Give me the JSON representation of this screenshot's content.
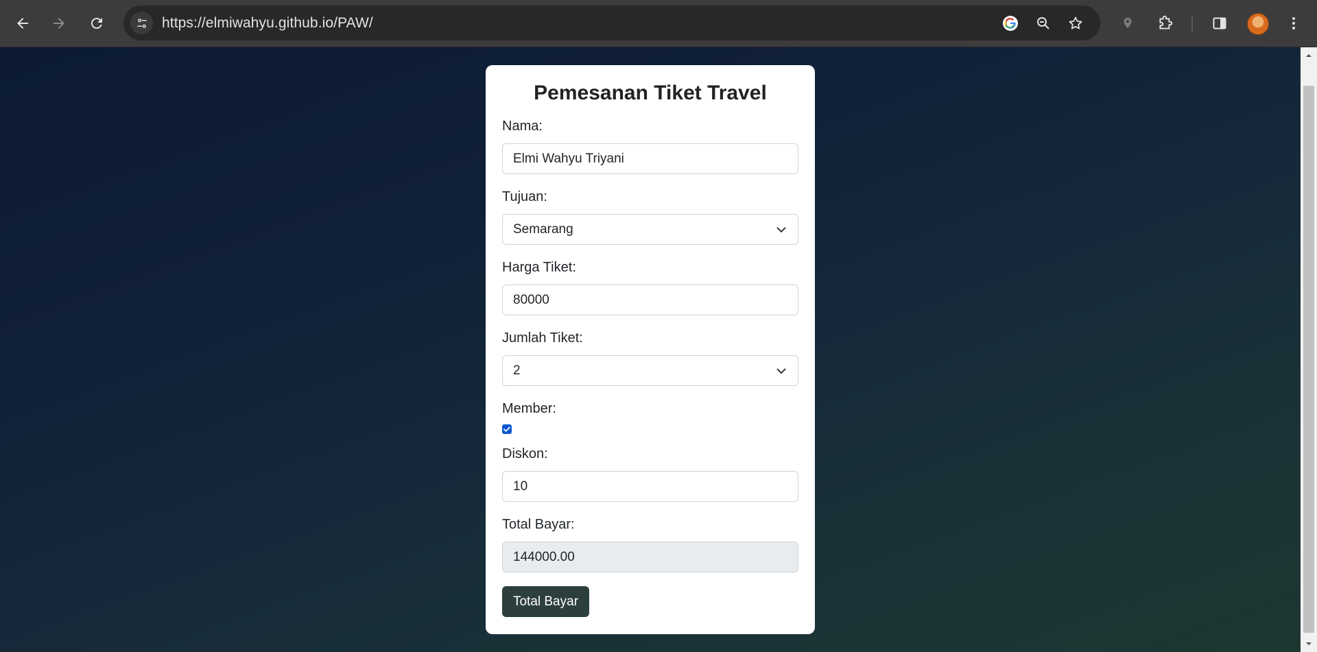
{
  "browser": {
    "url": "https://elmiwahyu.github.io/PAW/",
    "icons": {
      "back": "back-arrow-icon",
      "forward": "forward-arrow-icon",
      "reload": "reload-icon",
      "site_info": "tune-icon",
      "google": "google-icon",
      "zoom": "zoom-out-icon",
      "bookmark": "star-icon",
      "location": "location-pin-icon",
      "extensions": "puzzle-icon",
      "side_panel": "side-panel-icon",
      "profile": "avatar",
      "menu": "kebab-menu-icon"
    }
  },
  "form": {
    "title": "Pemesanan Tiket Travel",
    "nama": {
      "label": "Nama:",
      "value": "Elmi Wahyu Triyani"
    },
    "tujuan": {
      "label": "Tujuan:",
      "value": "Semarang"
    },
    "harga": {
      "label": "Harga Tiket:",
      "value": "80000"
    },
    "jumlah": {
      "label": "Jumlah Tiket:",
      "value": "2"
    },
    "member": {
      "label": "Member:",
      "checked": true
    },
    "diskon": {
      "label": "Diskon:",
      "value": "10"
    },
    "total": {
      "label": "Total Bayar:",
      "value": "144000.00"
    },
    "submit_label": "Total Bayar"
  },
  "colors": {
    "card_bg": "#ffffff",
    "button_bg": "#2d3f3c",
    "checkbox": "#0b57d0",
    "readonly_bg": "#e9ecef",
    "page_bg_top": "#0c1a33",
    "page_bg_bottom": "#1e3631"
  }
}
